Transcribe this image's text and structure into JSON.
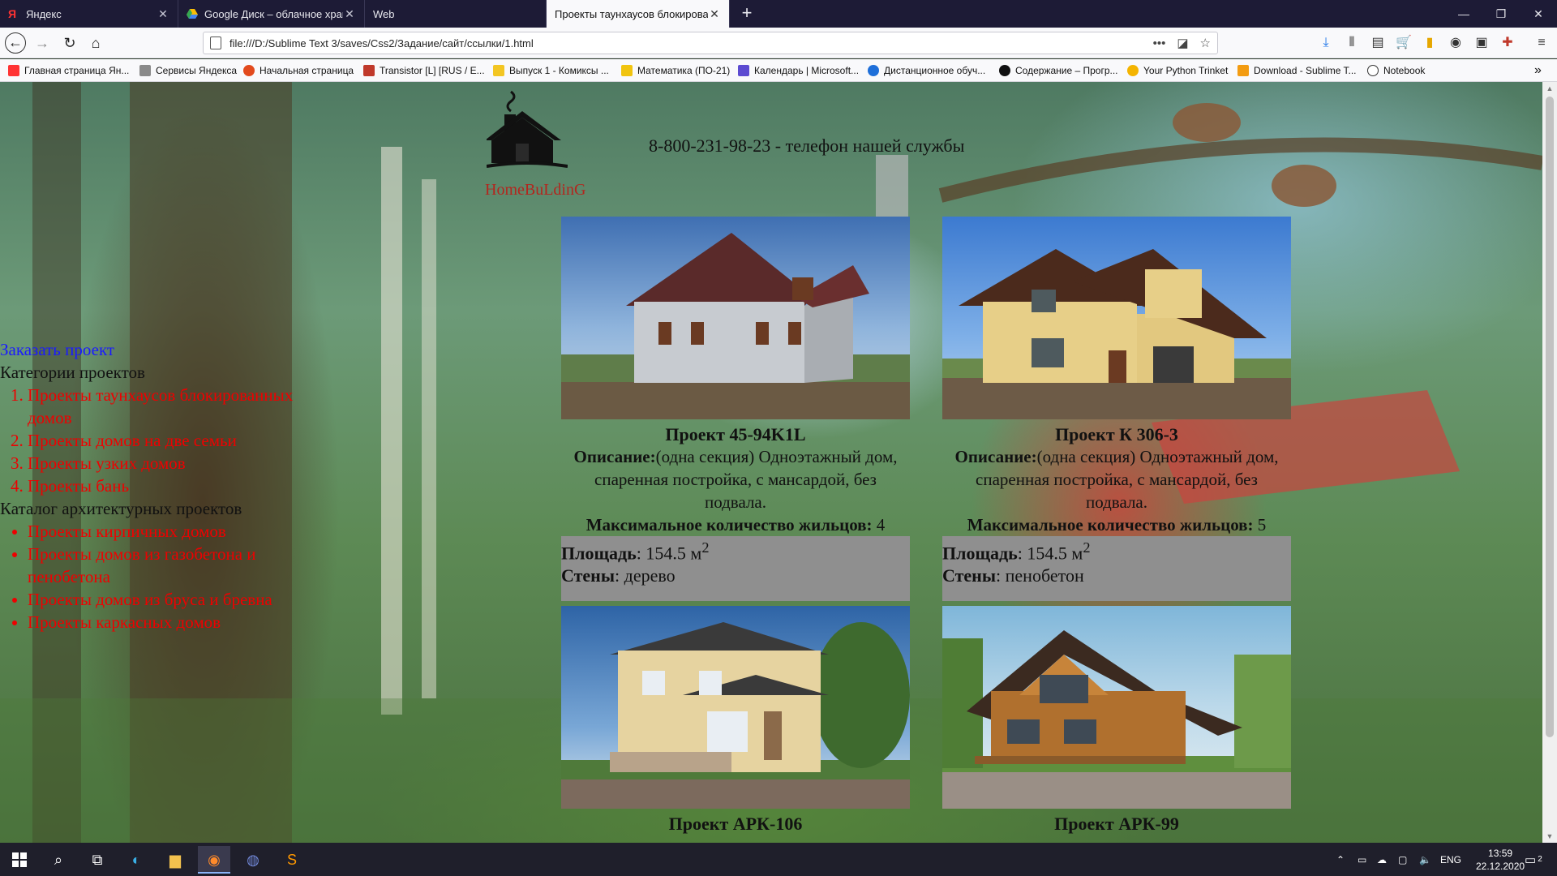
{
  "tabs": [
    {
      "title": "Яндекс",
      "icon": "yandex-icon",
      "color": "#ff3333"
    },
    {
      "title": "Google Диск – облачное хран",
      "icon": "google-drive-icon",
      "color": "#34a853"
    },
    {
      "title": "Web",
      "icon": "",
      "color": ""
    },
    {
      "title": "Проекты таунхаусов блокирован",
      "icon": "",
      "color": ""
    }
  ],
  "nav": {
    "url": "file:///D:/Sublime Text 3/saves/Css2/Задание/сайт/ссылки/1.html"
  },
  "bookmarks": [
    {
      "label": "Главная страница Ян...",
      "color": "#ff3333"
    },
    {
      "label": "Сервисы Яндекса",
      "color": "#8a8a8a"
    },
    {
      "label": "Начальная страница",
      "color": "#e24a1d"
    },
    {
      "label": "Transistor [L] [RUS / E...",
      "color": "#c0392b"
    },
    {
      "label": "Выпуск 1 - Комиксы ...",
      "color": "#f3c623"
    },
    {
      "label": "Математика (ПО-21)",
      "color": "#f1c40f"
    },
    {
      "label": "Календарь | Microsoft...",
      "color": "#5c4bd1"
    },
    {
      "label": "Дистанционное обуч...",
      "color": "#1e6fd9"
    },
    {
      "label": "Содержание – Прогр...",
      "color": "#111111"
    },
    {
      "label": "Your Python Trinket",
      "color": "#f4b400"
    },
    {
      "label": "Download - Sublime T...",
      "color": "#f39c12"
    },
    {
      "label": "Notebook",
      "color": "#333333"
    }
  ],
  "header": {
    "logo_text": "HomeBuLdinG",
    "phone": "8-800-231-98-23 - телефон нашей службы"
  },
  "menu": {
    "order_link": "Заказать проект",
    "categories_title": "Категории проектов",
    "categories": [
      "Проекты таунхаусов блокированных домов",
      "Проекты домов на две семьи",
      "Проекты узких домов",
      "Проекты бань"
    ],
    "catalog_title": "Каталог архитектурных проектов",
    "catalog": [
      "Проекты кирпичных домов",
      "Проекты домов из газобетона и пенобетона",
      "Проекты домов из бруса и бревна",
      "Проекты каркасных домов"
    ]
  },
  "projects": [
    {
      "title": "Проект 45-94K1L",
      "desc_label": "Описание:",
      "desc": "(одна секция) Одноэтажный дом, спаренная постройка, с мансардой, без подвала.",
      "max_label": "Максимальное количество жильцов:",
      "max": "4",
      "area_label": "Площадь",
      "area": ": 154.5 м",
      "area_sup": "2",
      "walls_label": "Стены",
      "walls": ": дерево"
    },
    {
      "title": "Проект К 306-3",
      "desc_label": "Описание:",
      "desc": "(одна секция) Одноэтажный дом, спаренная постройка, с мансардой, без подвала.",
      "max_label": "Максимальное количество жильцов:",
      "max": "5",
      "area_label": "Площадь",
      "area": ": 154.5 м",
      "area_sup": "2",
      "walls_label": "Стены",
      "walls": ": пенобетон"
    },
    {
      "title": "Проект АРК-106"
    },
    {
      "title": "Проект АРК-99"
    }
  ],
  "taskbar": {
    "lang": "ENG",
    "time": "13:59",
    "date": "22.12.2020",
    "notifications": "2"
  }
}
